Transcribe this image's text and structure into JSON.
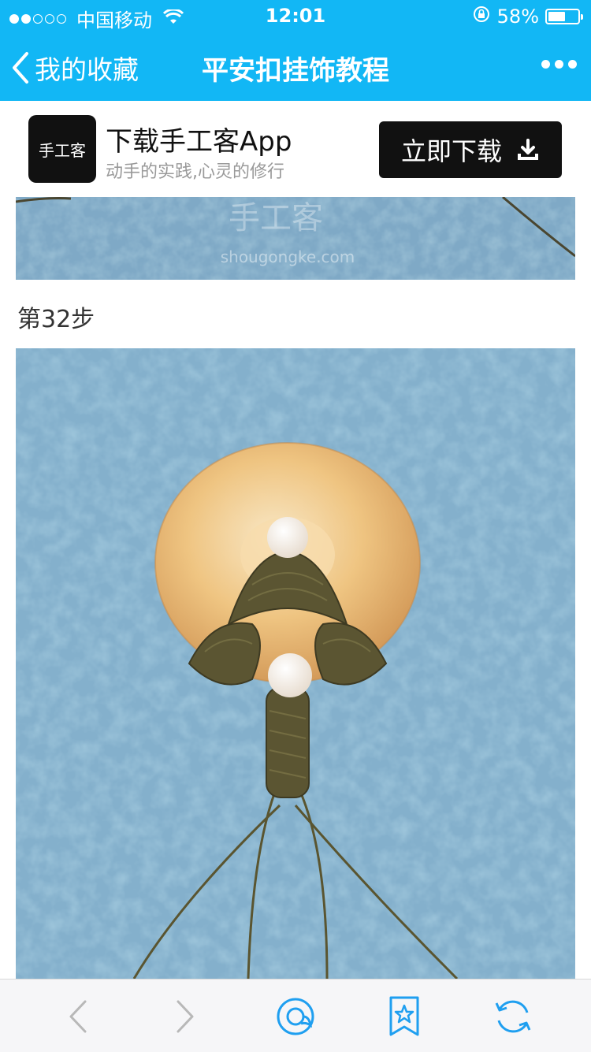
{
  "status_bar": {
    "signal_dots_filled": 2,
    "signal_dots_total": 5,
    "carrier": "中国移动",
    "time": "12:01",
    "battery_percent": "58%",
    "battery_level": 0.58
  },
  "nav": {
    "back_label": "我的收藏",
    "title": "平安扣挂饰教程",
    "more_icon": "more-dots-icon"
  },
  "ad": {
    "logo_text": "手工客",
    "title": "下载手工客App",
    "subtitle": "动手的实践,心灵的修行",
    "button_label": "立即下载",
    "button_icon": "download-icon"
  },
  "content": {
    "watermark_cn": "手工客",
    "watermark_url": "shougongke.com",
    "step_label": "第32步"
  },
  "toolbar": {
    "items": [
      "back-arrow-icon",
      "forward-arrow-icon",
      "share-chat-icon",
      "bookmark-star-icon",
      "refresh-icon"
    ]
  },
  "colors": {
    "accent": "#12b7f5",
    "toolbar_icon": "#1f9ff0",
    "disabled_icon": "#b8b8b8"
  }
}
